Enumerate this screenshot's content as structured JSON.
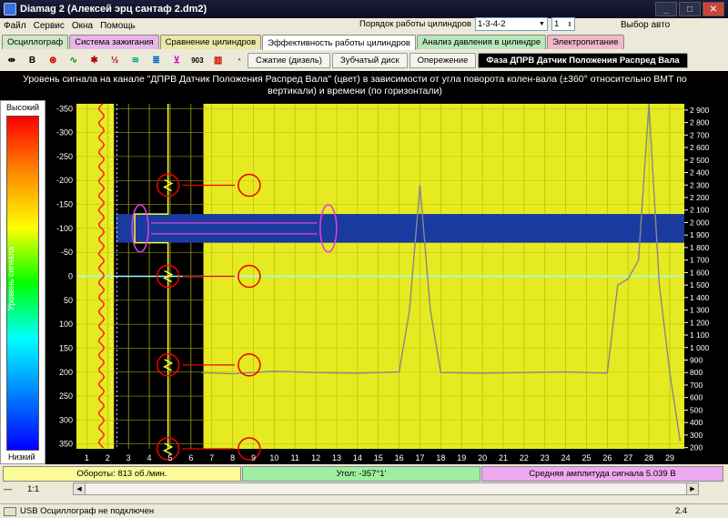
{
  "window": {
    "title": "Diamag 2 (Алексей эрц сантаф 2.dm2)",
    "minimize": "_",
    "maximize": "□",
    "close": "✕"
  },
  "menu": [
    "Файл",
    "Сервис",
    "Окна",
    "Помощь"
  ],
  "cylinder_order": {
    "label": "Порядок работы цилиндров",
    "value": "1-3-4-2",
    "count": "1"
  },
  "auto_select": "Выбор авто",
  "main_tabs": [
    {
      "label": "Осциллограф",
      "color": "#cfe8c8"
    },
    {
      "label": "Система зажигания",
      "color": "#e8b6e8"
    },
    {
      "label": "Сравнение цилиндров",
      "color": "#ece6a8"
    },
    {
      "label": "Эффективность работы цилиндров",
      "color": "#ffffff",
      "active": true
    },
    {
      "label": "Анализ давления в цилиндре",
      "color": "#b8e6b8"
    },
    {
      "label": "Электропитание",
      "color": "#f0b8c8"
    }
  ],
  "toolbar": [
    {
      "icon": "scale-icon",
      "glyph": "⇹"
    },
    {
      "icon": "bold-icon",
      "glyph": "B"
    },
    {
      "icon": "rpm-icon",
      "glyph": "⊛"
    },
    {
      "icon": "wave-icon",
      "glyph": "∿"
    },
    {
      "icon": "cursor-icon",
      "glyph": "✱"
    },
    {
      "icon": "half-icon",
      "glyph": "½"
    },
    {
      "icon": "level-icon",
      "glyph": "≋"
    },
    {
      "icon": "layers-icon",
      "glyph": "≣"
    },
    {
      "icon": "peak-icon",
      "glyph": "⊻"
    },
    {
      "icon": "number-icon",
      "glyph": "903"
    },
    {
      "icon": "bars-icon",
      "glyph": "▥"
    },
    {
      "icon": "pie-icon",
      "glyph": "◔"
    }
  ],
  "sub_tabs": [
    {
      "label": "Сжатие (дизель)"
    },
    {
      "label": "Зубчатый диск"
    },
    {
      "label": "Опережение"
    },
    {
      "label": "Фаза ДПРВ Датчик Положения Распред Вала",
      "active": true
    }
  ],
  "headline": "Уровень сигнала на канале \"ДПРВ Датчик Положения Распред Вала\" (цвет) в зависимости от угла поворота колен-вала (±360° относительно ВМТ по вертикали) и времени (по горизонтали)",
  "color_legend": {
    "high": "Высокий",
    "low": "Низкий",
    "label": "Уровень сигнала"
  },
  "chart_data": {
    "type": "heatmap",
    "left_axis_ticks": [
      "-350",
      "-300",
      "-250",
      "-200",
      "-150",
      "-100",
      "-50",
      "0",
      "50",
      "100",
      "150",
      "200",
      "250",
      "300",
      "350"
    ],
    "left_axis_range": [
      -360,
      360
    ],
    "right_axis_ticks": [
      "2 900",
      "2 800",
      "2 700",
      "2 600",
      "2 500",
      "2 400",
      "2 300",
      "2 200",
      "2 100",
      "2 000",
      "1 900",
      "1 800",
      "1 700",
      "1 600",
      "1 500",
      "1 400",
      "1 300",
      "1 200",
      "1 100",
      "1 000",
      "900",
      "800",
      "700",
      "600",
      "500",
      "400",
      "300",
      "200"
    ],
    "right_axis_range": [
      190,
      2950
    ],
    "x_axis_ticks": [
      "1",
      "2",
      "3",
      "4",
      "5",
      "6",
      "7",
      "8",
      "9",
      "10",
      "11",
      "12",
      "13",
      "14",
      "15",
      "16",
      "17",
      "18",
      "19",
      "20",
      "21",
      "22",
      "23",
      "24",
      "25",
      "26",
      "27",
      "28",
      "29"
    ],
    "blue_band_angle": [
      -130,
      -70
    ],
    "cyan_line_angle": 0,
    "rpm_trace": {
      "x": [
        6.5,
        8,
        10,
        12,
        14,
        16,
        16.5,
        17,
        17.5,
        18,
        20,
        22,
        24,
        25,
        26,
        26.5,
        27,
        27.5,
        28,
        28.5,
        29,
        29.5
      ],
      "y": [
        800,
        790,
        810,
        800,
        795,
        805,
        1300,
        2300,
        1300,
        800,
        795,
        800,
        805,
        800,
        795,
        1500,
        1550,
        1700,
        2950,
        1500,
        800,
        250
      ]
    },
    "sensor_pulse_angles": [
      -190,
      0,
      185,
      360
    ],
    "grid": true
  },
  "status": {
    "rpm": "Обороты: 813 об./мин.",
    "angle": "Угол: -357°1'",
    "amplitude": "Средняя амплитуда сигнала 5.039 В",
    "rpm_color": "#fbfb9a",
    "angle_color": "#9ef0a0",
    "amp_color": "#f0a8f0"
  },
  "zoom": "1:1",
  "bottom": {
    "usb": "USB Осциллограф не подключен",
    "version": "2.4"
  }
}
